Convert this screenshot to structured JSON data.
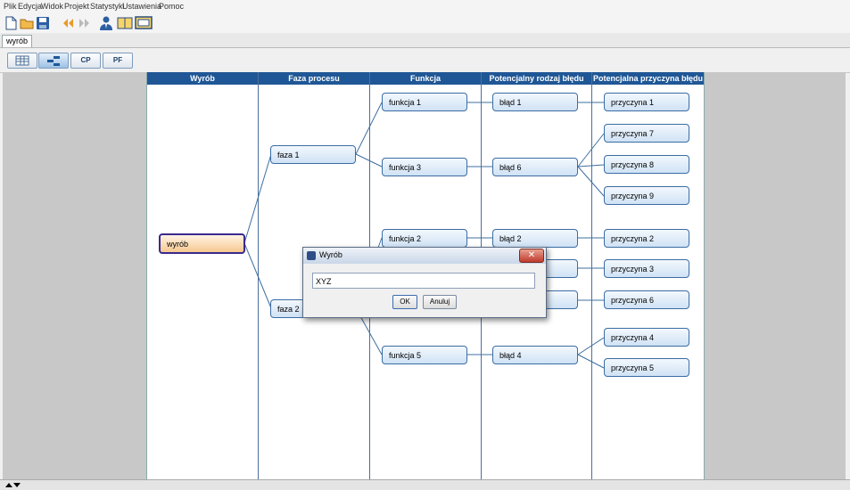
{
  "menu": [
    "Plik",
    "Edycja",
    "Widok",
    "Projekt",
    "Statystyki",
    "Ustawienia",
    "Pomoc"
  ],
  "tab": "wyrób",
  "view_buttons": [
    "",
    "",
    "CP",
    "PF"
  ],
  "columns": [
    "Wyrób",
    "Faza procesu",
    "Funkcja",
    "Potencjalny rodzaj błędu",
    "Potencjalna przyczyna błędu"
  ],
  "nodes": {
    "product": "wyrób",
    "phases": [
      "faza 1",
      "faza 2"
    ],
    "functions": [
      "funkcja 1",
      "funkcja 3",
      "funkcja 2",
      "funkcja 5"
    ],
    "errors": [
      "błąd 1",
      "błąd 6",
      "błąd 2",
      "błąd 4"
    ],
    "causes": [
      "przyczyna 1",
      "przyczyna 7",
      "przyczyna 8",
      "przyczyna 9",
      "przyczyna 2",
      "przyczyna 3",
      "przyczyna 6",
      "przyczyna 4",
      "przyczyna 5"
    ]
  },
  "dialog": {
    "title": "Wyrób",
    "input_value": "XYZ",
    "ok_label": "OK",
    "cancel_label": "Anuluj",
    "close_glyph": "✕"
  },
  "colors": {
    "header": "#1f5796",
    "node": "#cfe2f5",
    "root_node": "#f6c88f"
  }
}
